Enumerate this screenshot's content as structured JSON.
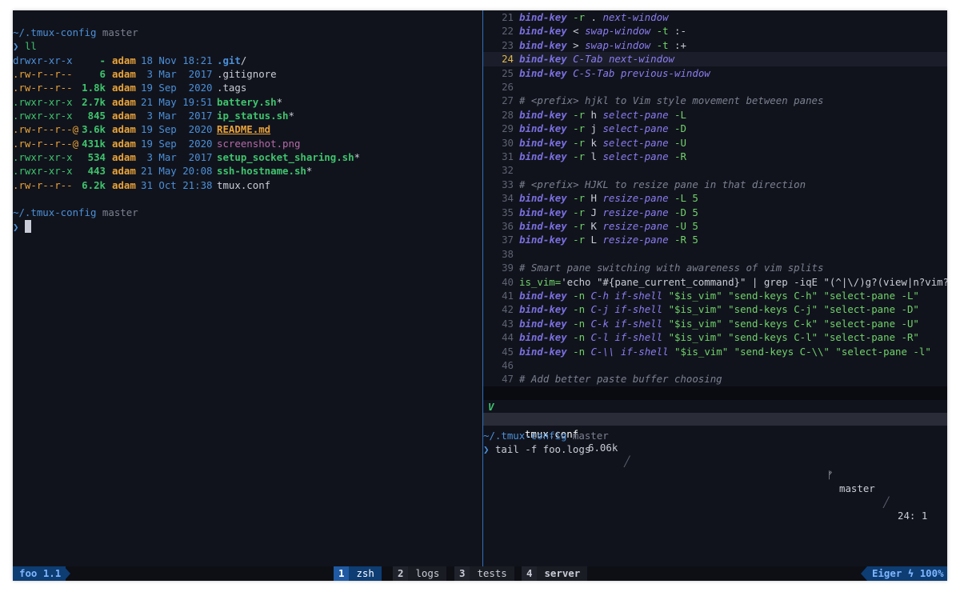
{
  "colors": {
    "background": "#11131c",
    "prompt_path": "#4a90d9",
    "prompt_branch": "#7b8190",
    "prompt_arrow": "#4a90d9",
    "dir": "#4a90d9",
    "exec": "#3ec46d",
    "user": "#e8a33a",
    "size": "#3ec46d",
    "date": "#4a90d9",
    "keyword": "#7a6fe0",
    "string": "#6fd36a",
    "comment": "#7b8190",
    "tmux_active_window": "#1f5aa3"
  },
  "left_pane": {
    "prompt1": {
      "path": "~/.tmux-config",
      "branch": "master",
      "arrow": "❯",
      "command": "ll"
    },
    "listing": [
      {
        "perms": "drwxr-xr-x",
        "size": "-",
        "user": "adam",
        "date": "18 Nov 18:21",
        "name": ".git",
        "suffix": "/",
        "kind": "dir"
      },
      {
        "perms": ".rw-r--r--",
        "size": "6",
        "user": "adam",
        "date": " 3 Mar  2017",
        "name": ".gitignore",
        "suffix": "",
        "kind": "plain"
      },
      {
        "perms": ".rw-r--r--",
        "size": "1.8k",
        "user": "adam",
        "date": "19 Sep  2020",
        "name": ".tags",
        "suffix": "",
        "kind": "plain"
      },
      {
        "perms": ".rwxr-xr-x",
        "size": "2.7k",
        "user": "adam",
        "date": "21 May 19:51",
        "name": "battery.sh",
        "suffix": "*",
        "kind": "exec"
      },
      {
        "perms": ".rwxr-xr-x",
        "size": "845",
        "user": "adam",
        "date": " 3 Mar  2017",
        "name": "ip_status.sh",
        "suffix": "*",
        "kind": "exec"
      },
      {
        "perms": ".rw-r--r--@",
        "size": "3.6k",
        "user": "adam",
        "date": "19 Sep  2020",
        "name": "README.md",
        "suffix": "",
        "kind": "readme"
      },
      {
        "perms": ".rw-r--r--@",
        "size": "431k",
        "user": "adam",
        "date": "19 Sep  2020",
        "name": "screenshot.png",
        "suffix": "",
        "kind": "image"
      },
      {
        "perms": ".rwxr-xr-x",
        "size": "534",
        "user": "adam",
        "date": " 3 Mar  2017",
        "name": "setup_socket_sharing.sh",
        "suffix": "*",
        "kind": "exec"
      },
      {
        "perms": ".rwxr-xr-x",
        "size": "443",
        "user": "adam",
        "date": "21 May 20:08",
        "name": "ssh-hostname.sh",
        "suffix": "*",
        "kind": "exec"
      },
      {
        "perms": ".rw-r--r--",
        "size": "6.2k",
        "user": "adam",
        "date": "31 Oct 21:38",
        "name": "tmux.conf",
        "suffix": "",
        "kind": "plain"
      }
    ],
    "prompt2": {
      "path": "~/.tmux-config",
      "branch": "master",
      "arrow": "❯"
    }
  },
  "editor": {
    "current_line": 24,
    "lines": [
      {
        "n": 21,
        "segs": [
          [
            "k",
            "bind-key"
          ],
          [
            "d",
            " "
          ],
          [
            "s",
            "-r"
          ],
          [
            "d",
            " . "
          ],
          [
            "f",
            "next-window"
          ]
        ]
      },
      {
        "n": 22,
        "segs": [
          [
            "k",
            "bind-key"
          ],
          [
            "d",
            " < "
          ],
          [
            "f",
            "swap-window"
          ],
          [
            "d",
            " "
          ],
          [
            "s",
            "-t"
          ],
          [
            "d",
            " :-"
          ]
        ]
      },
      {
        "n": 23,
        "segs": [
          [
            "k",
            "bind-key"
          ],
          [
            "d",
            " > "
          ],
          [
            "f",
            "swap-window"
          ],
          [
            "d",
            " "
          ],
          [
            "s",
            "-t"
          ],
          [
            "d",
            " :+"
          ]
        ]
      },
      {
        "n": 24,
        "segs": [
          [
            "k",
            "bind-key"
          ],
          [
            "d",
            " "
          ],
          [
            "f",
            "C-Tab"
          ],
          [
            "d",
            " "
          ],
          [
            "f",
            "next-window"
          ]
        ]
      },
      {
        "n": 25,
        "segs": [
          [
            "k",
            "bind-key"
          ],
          [
            "d",
            " "
          ],
          [
            "f",
            "C-S-Tab"
          ],
          [
            "d",
            " "
          ],
          [
            "f",
            "previous-window"
          ]
        ]
      },
      {
        "n": 26,
        "segs": []
      },
      {
        "n": 27,
        "segs": [
          [
            "c",
            "# <prefix> hjkl to Vim style movement between panes"
          ]
        ]
      },
      {
        "n": 28,
        "segs": [
          [
            "k",
            "bind-key"
          ],
          [
            "d",
            " "
          ],
          [
            "s",
            "-r"
          ],
          [
            "d",
            " h "
          ],
          [
            "f",
            "select-pane"
          ],
          [
            "d",
            " "
          ],
          [
            "s",
            "-L"
          ]
        ]
      },
      {
        "n": 29,
        "segs": [
          [
            "k",
            "bind-key"
          ],
          [
            "d",
            " "
          ],
          [
            "s",
            "-r"
          ],
          [
            "d",
            " j "
          ],
          [
            "f",
            "select-pane"
          ],
          [
            "d",
            " "
          ],
          [
            "s",
            "-D"
          ]
        ]
      },
      {
        "n": 30,
        "segs": [
          [
            "k",
            "bind-key"
          ],
          [
            "d",
            " "
          ],
          [
            "s",
            "-r"
          ],
          [
            "d",
            " k "
          ],
          [
            "f",
            "select-pane"
          ],
          [
            "d",
            " "
          ],
          [
            "s",
            "-U"
          ]
        ]
      },
      {
        "n": 31,
        "segs": [
          [
            "k",
            "bind-key"
          ],
          [
            "d",
            " "
          ],
          [
            "s",
            "-r"
          ],
          [
            "d",
            " l "
          ],
          [
            "f",
            "select-pane"
          ],
          [
            "d",
            " "
          ],
          [
            "s",
            "-R"
          ]
        ]
      },
      {
        "n": 32,
        "segs": []
      },
      {
        "n": 33,
        "segs": [
          [
            "c",
            "# <prefix> HJKL to resize pane in that direction"
          ]
        ]
      },
      {
        "n": 34,
        "segs": [
          [
            "k",
            "bind-key"
          ],
          [
            "d",
            " "
          ],
          [
            "s",
            "-r"
          ],
          [
            "d",
            " H "
          ],
          [
            "f",
            "resize-pane"
          ],
          [
            "d",
            " "
          ],
          [
            "s",
            "-L 5"
          ]
        ]
      },
      {
        "n": 35,
        "segs": [
          [
            "k",
            "bind-key"
          ],
          [
            "d",
            " "
          ],
          [
            "s",
            "-r"
          ],
          [
            "d",
            " J "
          ],
          [
            "f",
            "resize-pane"
          ],
          [
            "d",
            " "
          ],
          [
            "s",
            "-D 5"
          ]
        ]
      },
      {
        "n": 36,
        "segs": [
          [
            "k",
            "bind-key"
          ],
          [
            "d",
            " "
          ],
          [
            "s",
            "-r"
          ],
          [
            "d",
            " K "
          ],
          [
            "f",
            "resize-pane"
          ],
          [
            "d",
            " "
          ],
          [
            "s",
            "-U 5"
          ]
        ]
      },
      {
        "n": 37,
        "segs": [
          [
            "k",
            "bind-key"
          ],
          [
            "d",
            " "
          ],
          [
            "s",
            "-r"
          ],
          [
            "d",
            " L "
          ],
          [
            "f",
            "resize-pane"
          ],
          [
            "d",
            " "
          ],
          [
            "s",
            "-R 5"
          ]
        ]
      },
      {
        "n": 38,
        "segs": []
      },
      {
        "n": 39,
        "segs": [
          [
            "c",
            "# Smart pane switching with awareness of vim splits"
          ]
        ]
      },
      {
        "n": 40,
        "segs": [
          [
            "s",
            "is_vim="
          ],
          [
            "d",
            "'echo \"#{pane_current_command}\" | grep -iqE \"(^|\\/)g?(view|n?vim?)"
          ]
        ]
      },
      {
        "n": 41,
        "segs": [
          [
            "k",
            "bind-key"
          ],
          [
            "d",
            " "
          ],
          [
            "s",
            "-n"
          ],
          [
            "d",
            " "
          ],
          [
            "f",
            "C-h"
          ],
          [
            "d",
            " "
          ],
          [
            "f",
            "if-shell"
          ],
          [
            "d",
            " "
          ],
          [
            "s",
            "\"$is_vim\" \"send-keys C-h\" \"select-pane -L\""
          ]
        ]
      },
      {
        "n": 42,
        "segs": [
          [
            "k",
            "bind-key"
          ],
          [
            "d",
            " "
          ],
          [
            "s",
            "-n"
          ],
          [
            "d",
            " "
          ],
          [
            "f",
            "C-j"
          ],
          [
            "d",
            " "
          ],
          [
            "f",
            "if-shell"
          ],
          [
            "d",
            " "
          ],
          [
            "s",
            "\"$is_vim\" \"send-keys C-j\" \"select-pane -D\""
          ]
        ]
      },
      {
        "n": 43,
        "segs": [
          [
            "k",
            "bind-key"
          ],
          [
            "d",
            " "
          ],
          [
            "s",
            "-n"
          ],
          [
            "d",
            " "
          ],
          [
            "f",
            "C-k"
          ],
          [
            "d",
            " "
          ],
          [
            "f",
            "if-shell"
          ],
          [
            "d",
            " "
          ],
          [
            "s",
            "\"$is_vim\" \"send-keys C-k\" \"select-pane -U\""
          ]
        ]
      },
      {
        "n": 44,
        "segs": [
          [
            "k",
            "bind-key"
          ],
          [
            "d",
            " "
          ],
          [
            "s",
            "-n"
          ],
          [
            "d",
            " "
          ],
          [
            "f",
            "C-l"
          ],
          [
            "d",
            " "
          ],
          [
            "f",
            "if-shell"
          ],
          [
            "d",
            " "
          ],
          [
            "s",
            "\"$is_vim\" \"send-keys C-l\" \"select-pane -R\""
          ]
        ]
      },
      {
        "n": 45,
        "segs": [
          [
            "k",
            "bind-key"
          ],
          [
            "d",
            " "
          ],
          [
            "s",
            "-n"
          ],
          [
            "d",
            " "
          ],
          [
            "f",
            "C-\\\\"
          ],
          [
            "d",
            " "
          ],
          [
            "f",
            "if-shell"
          ],
          [
            "d",
            " "
          ],
          [
            "s",
            "\"$is_vim\" \"send-keys C-\\\\\" \"select-pane -l\""
          ]
        ]
      },
      {
        "n": 46,
        "segs": []
      },
      {
        "n": 47,
        "segs": [
          [
            "c",
            "# Add better paste buffer choosing"
          ]
        ]
      }
    ]
  },
  "vim_status": {
    "mode": "V",
    "file_icon": "✿",
    "filename": "tmux.conf",
    "filesize": "6.06k",
    "branch_icon": "ᚠ",
    "branch": "master",
    "position": "24: 1"
  },
  "bottom_pane": {
    "prompt": {
      "path": "~/.tmux-config",
      "branch": "master",
      "arrow": "❯",
      "command": "tail -f foo.logs"
    }
  },
  "tmux_status": {
    "session": "foo 1.1",
    "windows": [
      {
        "num": "1",
        "name": "zsh",
        "active": true
      },
      {
        "num": "2",
        "name": "logs",
        "active": false
      },
      {
        "num": "3",
        "name": "tests",
        "active": false
      },
      {
        "num": "4",
        "name": "server",
        "active": false
      }
    ],
    "host": "Eiger",
    "battery_icon": "ϟ",
    "battery": "100%"
  }
}
